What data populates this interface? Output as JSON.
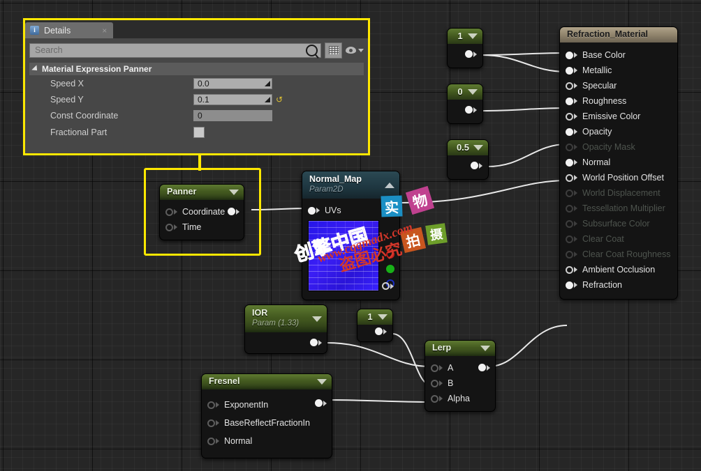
{
  "details_panel": {
    "tab_label": "Details",
    "tab_icon": "info-icon",
    "close_icon": "×",
    "search": {
      "placeholder": "Search",
      "value": ""
    },
    "toolbar": {
      "grid_view_icon": "grid-icon",
      "visibility_icon": "eye-icon"
    },
    "category": "Material Expression Panner",
    "properties": [
      {
        "label": "Speed X",
        "value": "0.0",
        "type": "number",
        "revert": false
      },
      {
        "label": "Speed Y",
        "value": "0.1",
        "type": "number",
        "revert": true,
        "revert_icon": "↺"
      },
      {
        "label": "Const Coordinate",
        "value": "0",
        "type": "flat",
        "revert": false
      },
      {
        "label": "Fractional Part",
        "value": "",
        "type": "checkbox",
        "checked": false
      }
    ]
  },
  "graph": {
    "material_node": {
      "title": "Refraction_Material",
      "pins": [
        {
          "label": "Base Color",
          "connected": true
        },
        {
          "label": "Metallic",
          "connected": true
        },
        {
          "label": "Specular",
          "connected": false
        },
        {
          "label": "Roughness",
          "connected": true
        },
        {
          "label": "Emissive Color",
          "connected": false
        },
        {
          "label": "Opacity",
          "connected": true
        },
        {
          "label": "Opacity Mask",
          "connected": false,
          "disabled": true
        },
        {
          "label": "Normal",
          "connected": true
        },
        {
          "label": "World Position Offset",
          "connected": false
        },
        {
          "label": "World Displacement",
          "connected": false,
          "disabled": true
        },
        {
          "label": "Tessellation Multiplier",
          "connected": false,
          "disabled": true
        },
        {
          "label": "Subsurface Color",
          "connected": false,
          "disabled": true
        },
        {
          "label": "Clear Coat",
          "connected": false,
          "disabled": true
        },
        {
          "label": "Clear Coat Roughness",
          "connected": false,
          "disabled": true
        },
        {
          "label": "Ambient Occlusion",
          "connected": false
        },
        {
          "label": "Refraction",
          "connected": true
        }
      ]
    },
    "constants": [
      {
        "value": "1"
      },
      {
        "value": "0"
      },
      {
        "value": "0.5"
      }
    ],
    "panner_node": {
      "title": "Panner",
      "inputs": [
        "Coordinate",
        "Time"
      ],
      "selected": true
    },
    "texture_node": {
      "title": "Normal_Map",
      "subtitle": "Param2D",
      "inputs": [
        "UVs"
      ],
      "collapse_icon": "chevron-up-icon"
    },
    "ior_node": {
      "title": "IOR",
      "subtitle": "Param (1.33)"
    },
    "const_one_node": {
      "value": "1"
    },
    "lerp_node": {
      "title": "Lerp",
      "inputs": [
        "A",
        "B",
        "Alpha"
      ]
    },
    "fresnel_node": {
      "title": "Fresnel",
      "inputs": [
        "ExponentIn",
        "BaseReflectFractionIn",
        "Normal"
      ]
    }
  },
  "watermarks": {
    "stickers": [
      {
        "glyph": "实",
        "color": "#1b8fc4"
      },
      {
        "glyph": "物",
        "color": "#c0418f"
      },
      {
        "glyph": "拍",
        "color": "#c8561f"
      },
      {
        "glyph": "摄",
        "color": "#6d9e2a"
      }
    ],
    "texts": [
      {
        "text": "创擎中国",
        "color": "#e83fb0"
      },
      {
        "text": "www.cqgmadx.com",
        "color": "#d4372a"
      },
      {
        "text": "盗图必究",
        "color": "#d4372a"
      }
    ]
  },
  "colors": {
    "selection": "#ffe800",
    "node_green": "#495f26",
    "node_teal": "#1e3640",
    "node_tan": "#8d816a",
    "background": "#262626"
  }
}
